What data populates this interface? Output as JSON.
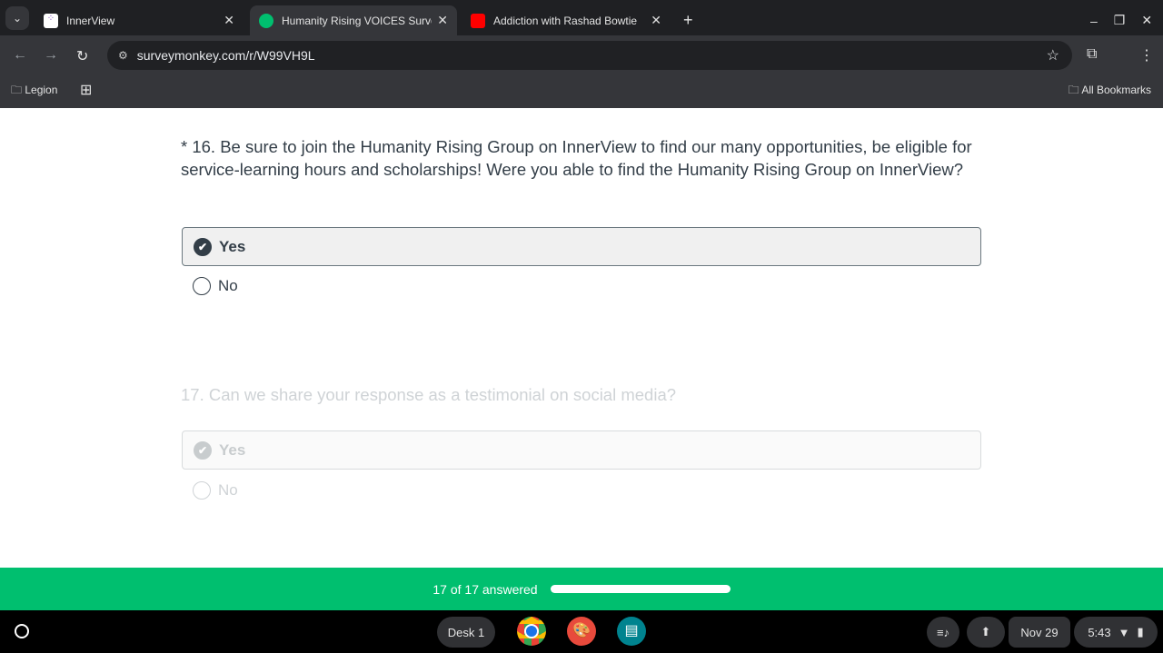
{
  "browser": {
    "tabs": [
      {
        "title": "InnerView"
      },
      {
        "title": "Humanity Rising VOICES Survey"
      },
      {
        "title": "Addiction with Rashad Bowtie M"
      }
    ],
    "url": "surveymonkey.com/r/W99VH9L",
    "bookmarks": [
      {
        "label": "Legion"
      }
    ],
    "all_bookmarks": "All Bookmarks"
  },
  "survey": {
    "q16": {
      "text": "* 16. Be sure to join the Humanity Rising Group on InnerView to find our many opportunities, be eligible for service-learning hours and scholarships! Were you able to find the Humanity Rising Group on InnerView?",
      "options": [
        "Yes",
        "No"
      ],
      "selected": "Yes"
    },
    "q17": {
      "text": "17. Can we share your response as a testimonial on social media?",
      "options": [
        "Yes",
        "No"
      ],
      "selected": "Yes"
    }
  },
  "progress": {
    "label": "17 of 17 answered",
    "fraction": 1.0,
    "color": "#00bf6f"
  },
  "shelf": {
    "desk": "Desk 1",
    "date": "Nov 29",
    "time": "5:43"
  }
}
